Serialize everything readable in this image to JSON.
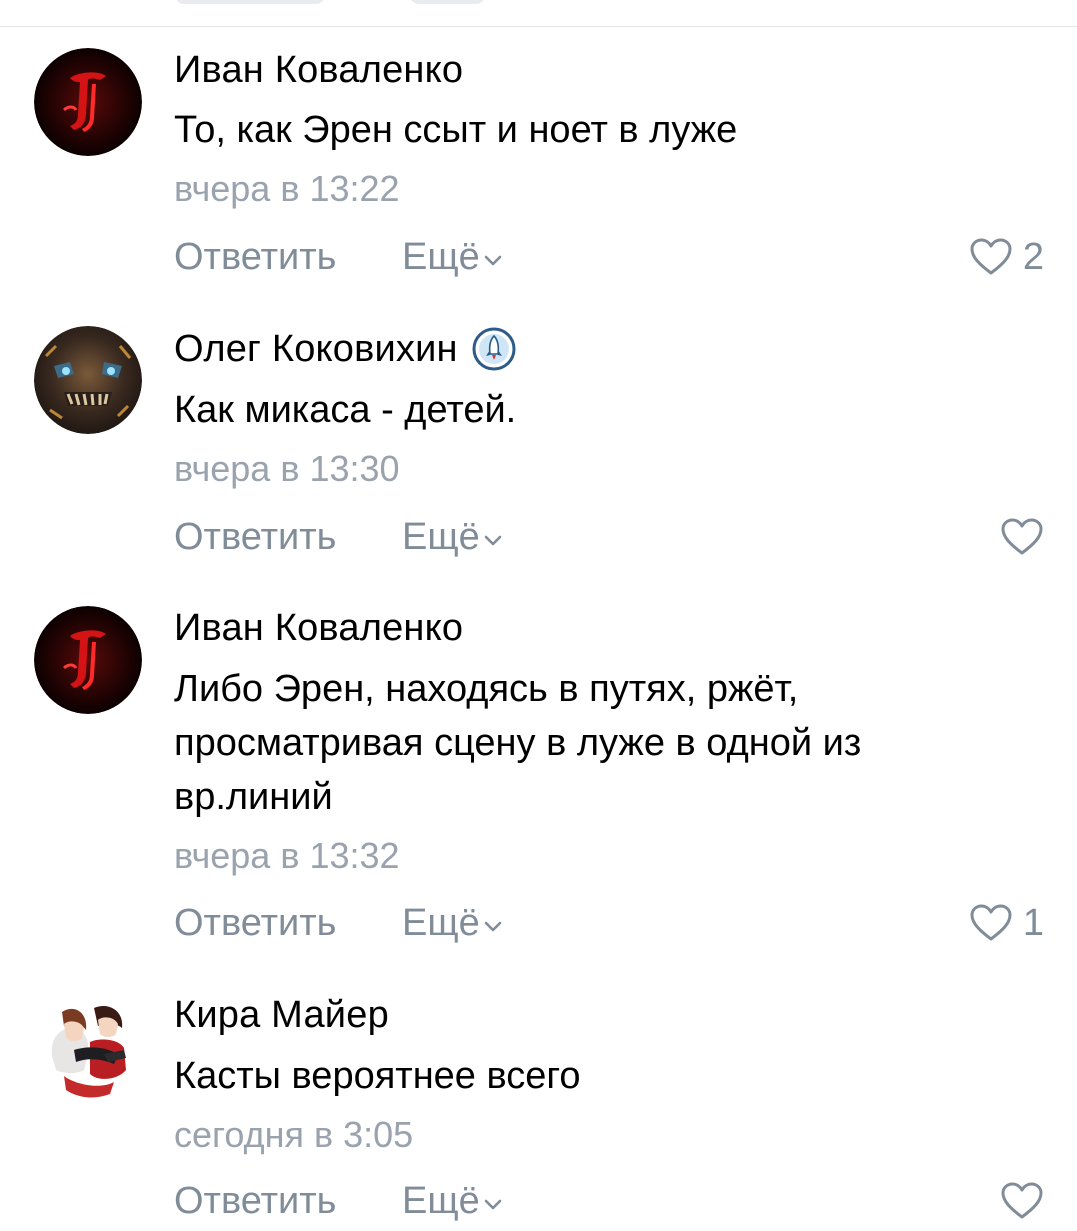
{
  "comments": [
    {
      "author": "Иван Коваленко",
      "text": "То, как Эрен ссыт и ноет в луже",
      "time": "вчера в 13:22",
      "reply_label": "Ответить",
      "more_label": "Ещё",
      "likes": "2",
      "avatar": "red-ornate-letter-logo"
    },
    {
      "author": "Олег Коковихин",
      "text": "Как микаса - детей.",
      "time": "вчера в 13:30",
      "reply_label": "Ответить",
      "more_label": "Ещё",
      "likes": "",
      "avatar": "titan-face-artwork",
      "badge": "rocket-badge-icon"
    },
    {
      "author": "Иван Коваленко",
      "text": "Либо Эрен, находясь в путях, ржёт, просматривая сцену в луже в одной из вр.линий",
      "time": "вчера в 13:32",
      "reply_label": "Ответить",
      "more_label": "Ещё",
      "likes": "1",
      "avatar": "red-ornate-letter-logo"
    },
    {
      "author": "Кира Майер",
      "text": "Касты вероятнее всего",
      "time": "сегодня в 3:05",
      "reply_label": "Ответить",
      "more_label": "Ещё",
      "likes": "",
      "avatar": "anime-couple-artwork"
    }
  ],
  "colors": {
    "author": "#000000",
    "text": "#000000",
    "meta": "#99a2ad",
    "action": "#818c99",
    "divider": "#e3e4e8"
  }
}
